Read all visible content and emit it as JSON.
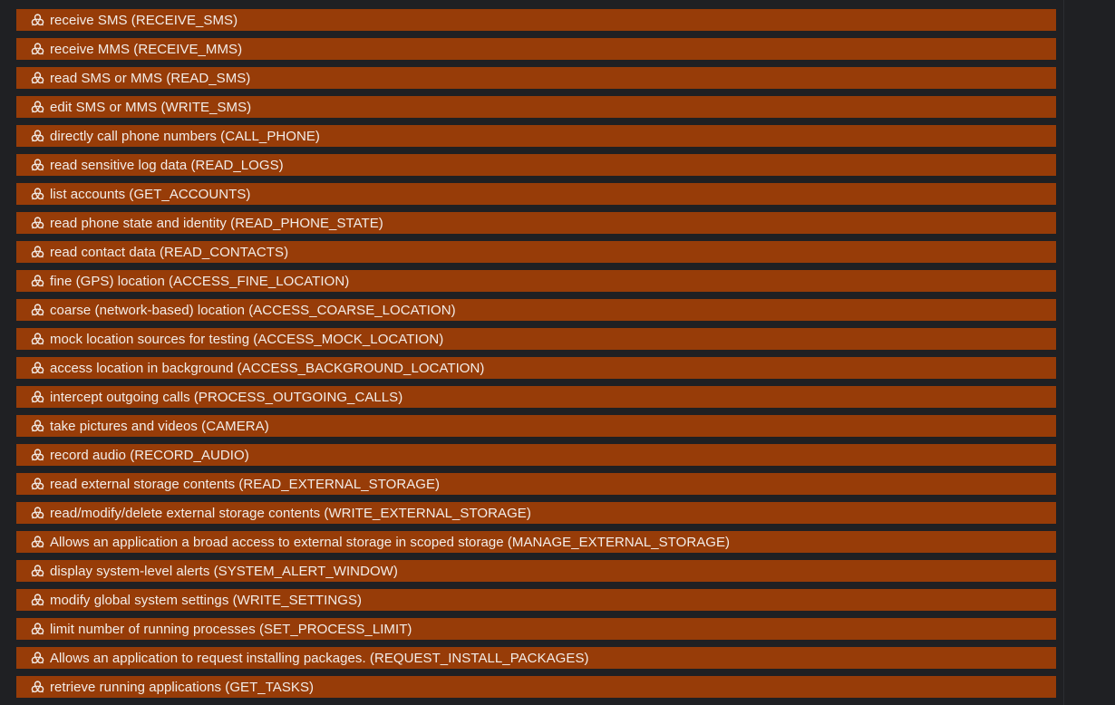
{
  "icon": "biohazard-icon",
  "colors": {
    "background": "#1f2023",
    "row_background": "#973c08",
    "row_text": "#f2ece8"
  },
  "permissions": [
    "receive SMS (RECEIVE_SMS)",
    "receive MMS (RECEIVE_MMS)",
    "read SMS or MMS (READ_SMS)",
    "edit SMS or MMS (WRITE_SMS)",
    "directly call phone numbers (CALL_PHONE)",
    "read sensitive log data (READ_LOGS)",
    "list accounts (GET_ACCOUNTS)",
    "read phone state and identity (READ_PHONE_STATE)",
    "read contact data (READ_CONTACTS)",
    "fine (GPS) location (ACCESS_FINE_LOCATION)",
    "coarse (network-based) location (ACCESS_COARSE_LOCATION)",
    "mock location sources for testing (ACCESS_MOCK_LOCATION)",
    "access location in background (ACCESS_BACKGROUND_LOCATION)",
    "intercept outgoing calls (PROCESS_OUTGOING_CALLS)",
    "take pictures and videos (CAMERA)",
    "record audio (RECORD_AUDIO)",
    "read external storage contents (READ_EXTERNAL_STORAGE)",
    "read/modify/delete external storage contents (WRITE_EXTERNAL_STORAGE)",
    "Allows an application a broad access to external storage in scoped storage (MANAGE_EXTERNAL_STORAGE)",
    "display system-level alerts (SYSTEM_ALERT_WINDOW)",
    "modify global system settings (WRITE_SETTINGS)",
    "limit number of running processes (SET_PROCESS_LIMIT)",
    "Allows an application to request installing packages. (REQUEST_INSTALL_PACKAGES)",
    "retrieve running applications (GET_TASKS)"
  ]
}
